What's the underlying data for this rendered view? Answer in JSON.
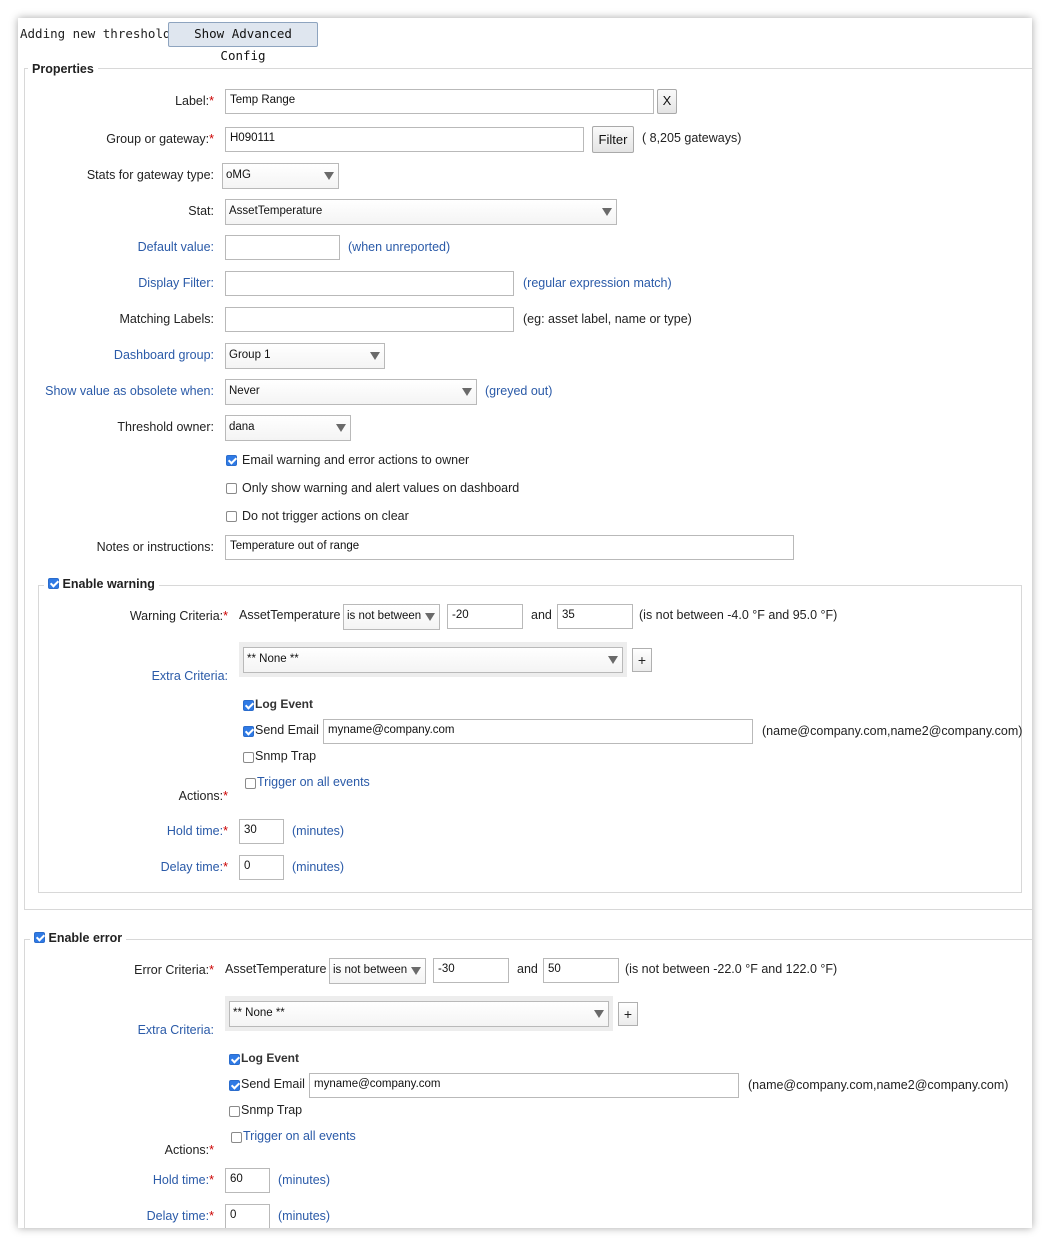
{
  "header": {
    "title": "Adding new threshold",
    "advanced_button": "Show Advanced Config"
  },
  "properties": {
    "legend": "Properties",
    "label": {
      "label": "Label:",
      "value": "Temp Range",
      "clear_button": "X"
    },
    "group": {
      "label": "Group or gateway:",
      "value": "H090111",
      "filter_button": "Filter",
      "count_note": "( 8,205 gateways)"
    },
    "gateway_type": {
      "label": "Stats for gateway type:",
      "value": "oMG"
    },
    "stat": {
      "label": "Stat:",
      "value": "AssetTemperature"
    },
    "default_value": {
      "label": "Default value:",
      "value": "",
      "note": "(when unreported)"
    },
    "display_filter": {
      "label": "Display Filter:",
      "value": "",
      "note": "(regular expression match)"
    },
    "matching_labels": {
      "label": "Matching Labels:",
      "value": "",
      "note": "(eg: asset label, name or type)"
    },
    "dashboard_group": {
      "label": "Dashboard group:",
      "value": "Group 1"
    },
    "obsolete": {
      "label": "Show value as obsolete when:",
      "value": "Never",
      "note": "(greyed out)"
    },
    "owner": {
      "label": "Threshold owner:",
      "value": "dana"
    },
    "checkboxes": [
      {
        "label": "Email warning and error actions to owner",
        "checked": true
      },
      {
        "label": "Only show warning and alert values on dashboard",
        "checked": false
      },
      {
        "label": "Do not trigger actions on clear",
        "checked": false
      }
    ],
    "notes": {
      "label": "Notes or instructions:",
      "value": "Temperature out of range"
    }
  },
  "warning": {
    "legend": "Enable warning",
    "enabled": true,
    "criteria_label": "Warning Criteria:",
    "stat": "AssetTemperature",
    "operator": "is not between",
    "low": "-20",
    "and": "and",
    "high": "35",
    "explain": "(is not between -4.0 °F and 95.0 °F)",
    "extra_label": "Extra Criteria:",
    "extra_value": "** None **",
    "plus": "+",
    "log_event": "Log Event",
    "send_email": "Send Email",
    "email_value": "myname@company.com",
    "email_hint": "(name@company.com,name2@company.com)",
    "snmp": "Snmp Trap",
    "trigger_all": "Trigger on all events",
    "actions_label": "Actions:",
    "hold_label": "Hold time:",
    "hold_value": "30",
    "delay_label": "Delay time:",
    "delay_value": "0",
    "minutes": "(minutes)"
  },
  "error": {
    "legend": "Enable error",
    "enabled": true,
    "criteria_label": "Error Criteria:",
    "stat": "AssetTemperature",
    "operator": "is not between",
    "low": "-30",
    "and": "and",
    "high": "50",
    "explain": "(is not between -22.0 °F and 122.0 °F)",
    "extra_label": "Extra Criteria:",
    "extra_value": "** None **",
    "plus": "+",
    "log_event": "Log Event",
    "send_email": "Send Email",
    "email_value": "myname@company.com",
    "email_hint": "(name@company.com,name2@company.com)",
    "snmp": "Snmp Trap",
    "trigger_all": "Trigger on all events",
    "actions_label": "Actions:",
    "hold_label": "Hold time:",
    "hold_value": "60",
    "delay_label": "Delay time:",
    "delay_value": "0",
    "minutes": "(minutes)"
  }
}
